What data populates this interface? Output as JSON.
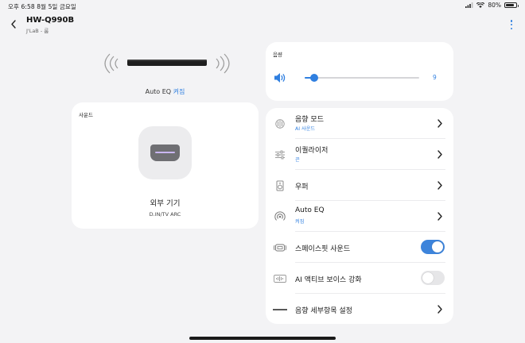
{
  "status_bar": {
    "time_date": "오후 6:58   8월 5일 금요일",
    "battery_text": "80%",
    "battery_level": 0.8
  },
  "header": {
    "device_name": "HW-Q990B",
    "device_sub": "J'LaB - 룸"
  },
  "soundbar": {
    "autoeq_label": "Auto EQ",
    "autoeq_state": "켜짐"
  },
  "source_card": {
    "caption": "사운드",
    "source_name": "외부 기기",
    "source_detail": "D.IN/TV ARC",
    "icon": "hdmi-icon"
  },
  "volume": {
    "caption": "음량",
    "value": "9",
    "level": 0.08,
    "accent": "#2f7fe0"
  },
  "settings": {
    "rows": [
      {
        "title": "음향 모드",
        "sub": "AI 사운드",
        "icon": "sound-mode-icon",
        "control": "chevron"
      },
      {
        "title": "이퀄라이저",
        "sub": "끈",
        "icon": "equalizer-icon",
        "control": "chevron"
      },
      {
        "title": "우퍼",
        "sub": "",
        "icon": "speaker-icon",
        "control": "chevron"
      },
      {
        "title": "Auto EQ",
        "sub": "켜짐",
        "icon": "auto-eq-icon",
        "control": "chevron"
      },
      {
        "title": "스페이스핏 사운드",
        "sub": "",
        "icon": "spacefit-icon",
        "control": "toggle",
        "toggle_on": true
      },
      {
        "title": "AI 액티브 보이스 강화",
        "sub": "",
        "icon": "voice-icon",
        "control": "toggle",
        "toggle_on": false
      },
      {
        "title": "음향 세부항목 설정",
        "sub": "",
        "icon": "divider-line-icon",
        "control": "chevron"
      }
    ]
  },
  "colors": {
    "accent": "#2f7fe0",
    "background": "#f3f3f5",
    "card": "#ffffff",
    "toggle_on": "#3d84db"
  }
}
